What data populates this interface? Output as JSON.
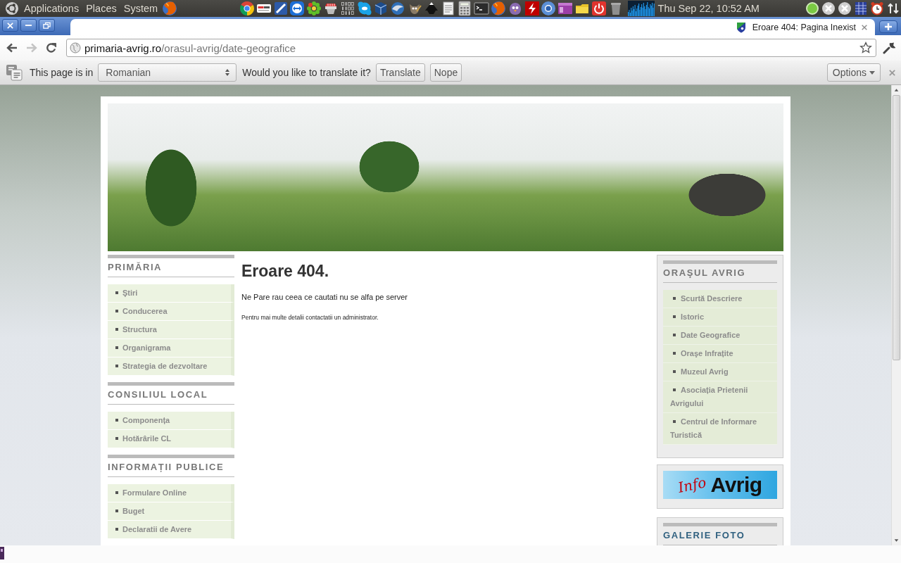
{
  "top_panel": {
    "menus": [
      "Applications",
      "Places",
      "System"
    ],
    "clock": "Thu Sep 22, 10:52 AM"
  },
  "browser": {
    "tabs": [
      {
        "title": "Eroare 404: Pagina Inexist",
        "selected": true
      }
    ],
    "nav_buttons": [
      {
        "kind": "back",
        "disabled": false
      },
      {
        "kind": "forward",
        "disabled": true
      },
      {
        "kind": "reload",
        "disabled": false
      }
    ],
    "address": {
      "host": "primaria-avrig.ro",
      "path": "/orasul-avrig/date-geografice"
    }
  },
  "translate_bar": {
    "prompt": "This page is in",
    "language": "Romanian",
    "question": "Would you like to translate it?",
    "buttons": [
      "Translate",
      "Nope"
    ],
    "options": "Options"
  },
  "page": {
    "left_sidebar": [
      {
        "title": "PRIMĂRIA",
        "items": [
          "Ştiri",
          "Conducerea",
          "Structura",
          "Organigrama",
          "Strategia de dezvoltare"
        ]
      },
      {
        "title": "CONSILIUL LOCAL",
        "items": [
          "Componența",
          "Hotărârile CL"
        ]
      },
      {
        "title": "INFORMAȚII PUBLICE",
        "items": [
          "Formulare Online",
          "Buget",
          "Declaratii de Avere"
        ]
      }
    ],
    "content": {
      "heading": "Eroare 404.",
      "message": "Ne Pare rau ceea ce cautati nu se alfa pe server",
      "note": "Pentru mai multe detalii contactatii un administrator."
    },
    "right_sidebar": {
      "menu": {
        "title": "ORAŞUL AVRIG",
        "items": [
          "Scurtă Descriere",
          "Istoric",
          "Date Geografice",
          "Oraşe Infrațite",
          "Muzeul Avrig",
          "Asociația Prietenii Avrigului",
          "Centrul de Informare Turistică"
        ]
      },
      "banner": {
        "script": "Info",
        "title": "Avrig"
      },
      "gallery": {
        "title": "GALERIE FOTO"
      }
    }
  }
}
